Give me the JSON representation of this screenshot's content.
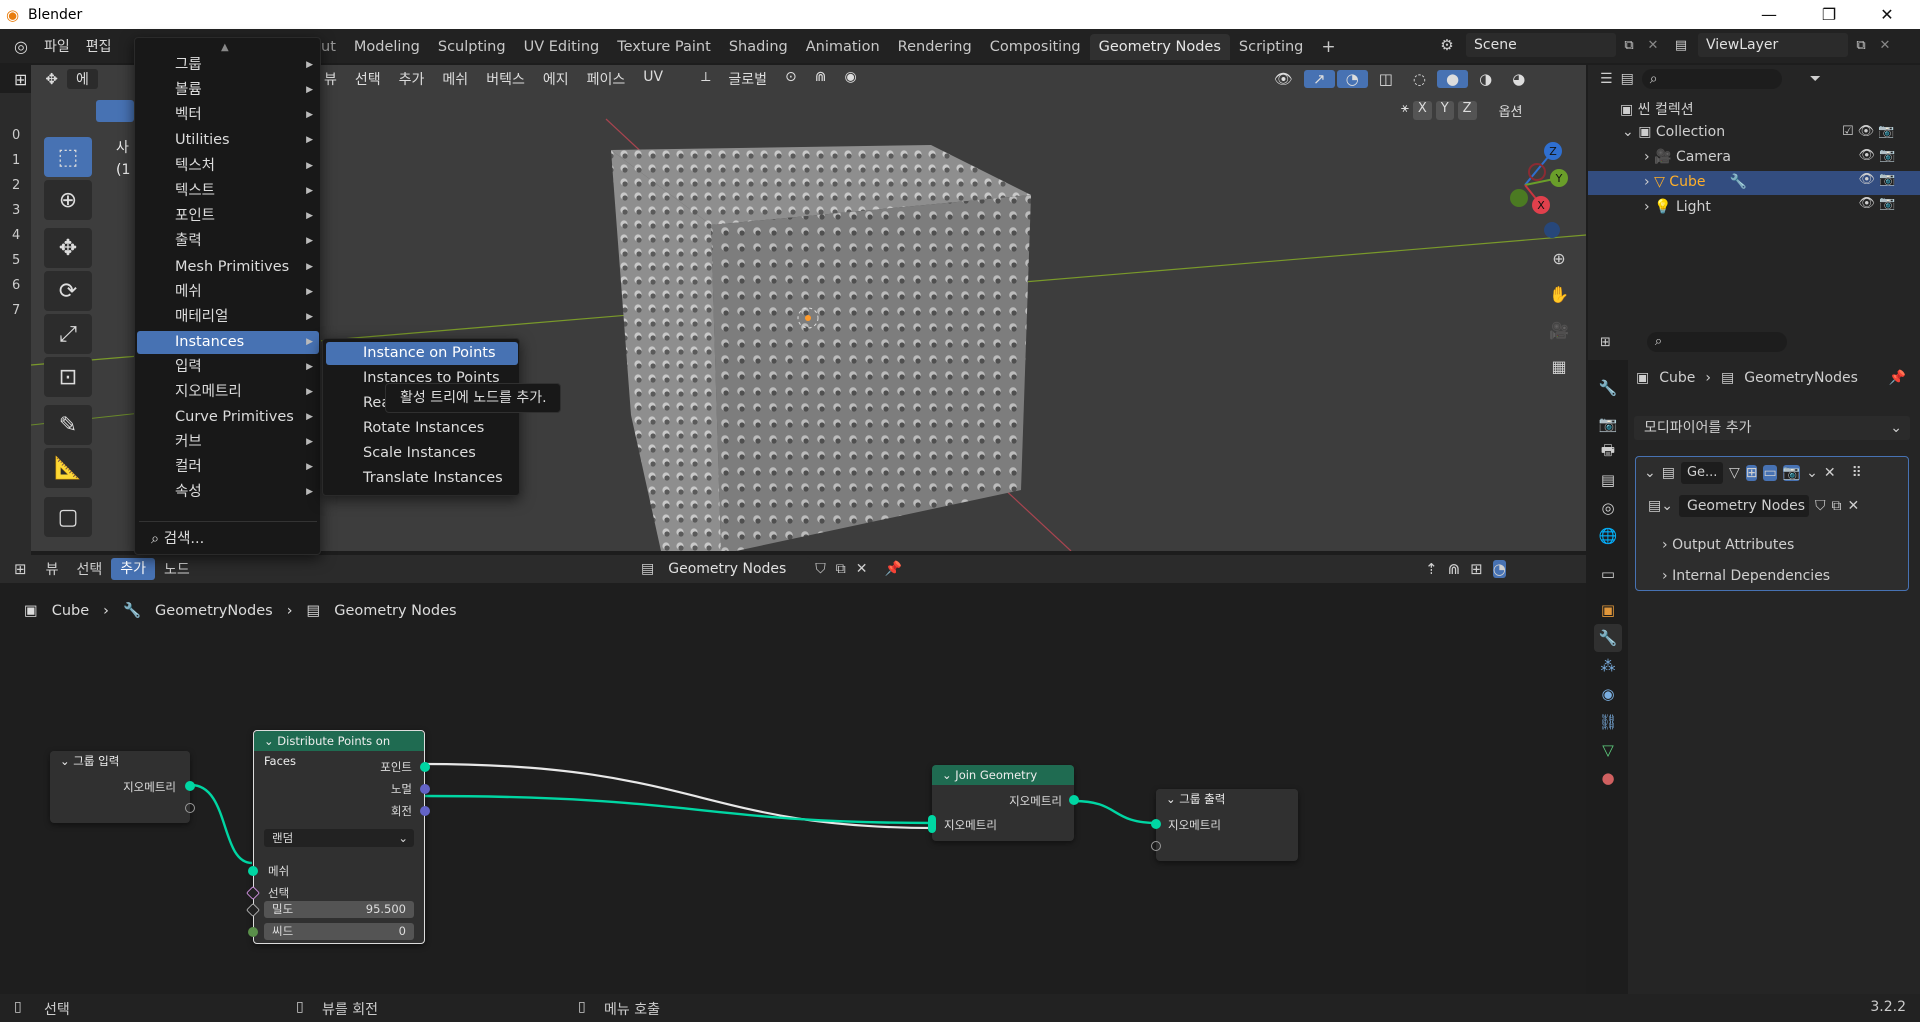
{
  "app": {
    "title": "Blender",
    "version": "3.2.2"
  },
  "menu": {
    "file": "파일",
    "edit": "편집",
    "ut": "ut"
  },
  "workspaces": [
    "Modeling",
    "Sculpting",
    "UV Editing",
    "Texture Paint",
    "Shading",
    "Animation",
    "Rendering",
    "Compositing",
    "Geometry Nodes",
    "Scripting"
  ],
  "active_workspace": "Geometry Nodes",
  "scene": {
    "name": "Scene",
    "viewlayer": "ViewLayer"
  },
  "viewport": {
    "menus": [
      "뷰",
      "선택",
      "추가",
      "메쉬",
      "버텍스",
      "에지",
      "페이스",
      "UV"
    ],
    "orientation": "글로벌",
    "options": "옵션",
    "xyz": [
      "X",
      "Y",
      "Z"
    ],
    "overlay_text": [
      "사",
      "(1"
    ],
    "row_numbers": [
      "0",
      "1",
      "2",
      "3",
      "4",
      "5",
      "6",
      "7"
    ],
    "left_label": "에"
  },
  "add_menu": {
    "items": [
      {
        "label": "그룹",
        "sub": true
      },
      {
        "label": "볼륨",
        "sub": true
      },
      {
        "label": "벡터",
        "sub": true
      },
      {
        "label": "Utilities",
        "sub": true
      },
      {
        "label": "텍스처",
        "sub": true
      },
      {
        "label": "텍스트",
        "sub": true
      },
      {
        "label": "포인트",
        "sub": true
      },
      {
        "label": "출력",
        "sub": true
      },
      {
        "label": "Mesh Primitives",
        "sub": true
      },
      {
        "label": "메쉬",
        "sub": true
      },
      {
        "label": "매테리얼",
        "sub": true
      },
      {
        "label": "Instances",
        "sub": true,
        "active": true
      },
      {
        "label": "입력",
        "sub": true
      },
      {
        "label": "지오메트리",
        "sub": true
      },
      {
        "label": "Curve Primitives",
        "sub": true
      },
      {
        "label": "커브",
        "sub": true
      },
      {
        "label": "컬러",
        "sub": true
      },
      {
        "label": "속성",
        "sub": true
      }
    ],
    "search": "검색..."
  },
  "instances_submenu": [
    "Instance on Points",
    "Instances to Points",
    "Rea",
    "Rotate Instances",
    "Scale Instances",
    "Translate Instances"
  ],
  "tooltip": "활성 트리에 노드를 추가.",
  "node_editor": {
    "menus": [
      "뷰",
      "선택",
      "추가",
      "노드"
    ],
    "active_menu": "추가",
    "tree": "Geometry Nodes",
    "breadcrumb": [
      "Cube",
      "GeometryNodes",
      "Geometry Nodes"
    ]
  },
  "nodes": {
    "group_input": {
      "title": "그룹 입력",
      "out": "지오메트리"
    },
    "distribute": {
      "title": "Distribute Points on Faces",
      "outs": [
        "포인트",
        "노멀",
        "회전"
      ],
      "mode": "랜덤",
      "ins": [
        "메쉬",
        "선택"
      ],
      "density_label": "밀도",
      "density": "95.500",
      "seed_label": "씨드",
      "seed": "0"
    },
    "join": {
      "title": "Join Geometry",
      "out": "지오메트리",
      "in": "지오메트리"
    },
    "group_output": {
      "title": "그룹 출력",
      "in": "지오메트리"
    }
  },
  "outliner": {
    "root": "씬 컬렉션",
    "collection": "Collection",
    "items": [
      "Camera",
      "Cube",
      "Light"
    ],
    "selected": "Cube"
  },
  "properties": {
    "breadcrumb": [
      "Cube",
      "GeometryNodes"
    ],
    "add_modifier": "모디파이어를 추가",
    "modifier_short": "Ge...",
    "node_group": "Geometry Nodes",
    "sections": [
      "Output Attributes",
      "Internal Dependencies"
    ]
  },
  "status": {
    "select": "선택",
    "rotate": "뷰를 회전",
    "menu": "메뉴 호출"
  },
  "colors": {
    "accent": "#4772b3",
    "geo_socket": "#00d6a3",
    "node_header_green": "#1f6b51",
    "active_orange": "#ffaf29"
  }
}
